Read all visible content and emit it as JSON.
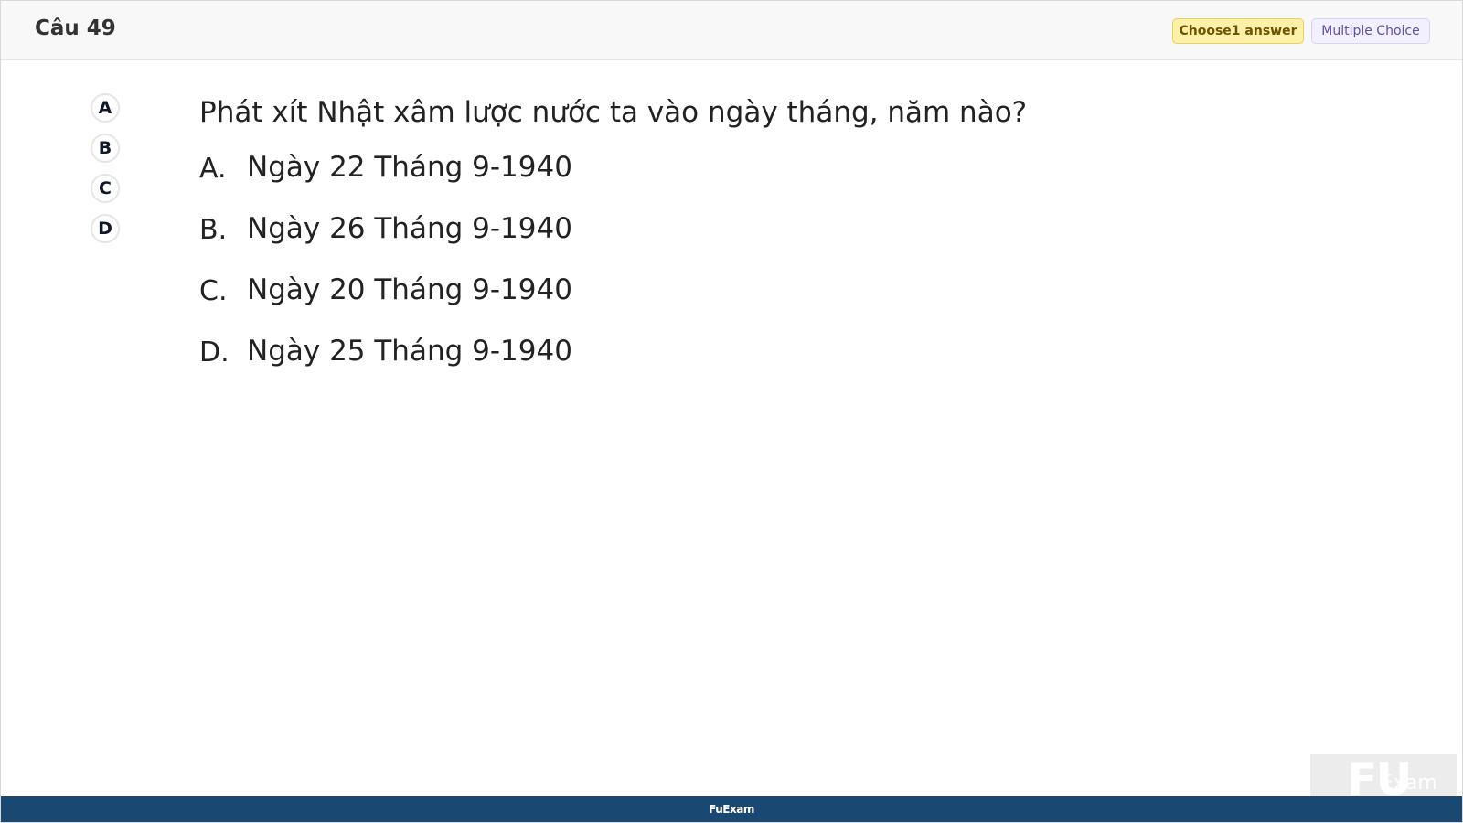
{
  "header": {
    "question_number": "Câu 49",
    "choose_badge": "Choose1 answer",
    "type_badge": "Multiple Choice"
  },
  "navigator": {
    "choices": [
      "A",
      "B",
      "C",
      "D"
    ]
  },
  "question": {
    "text": "Phát xít Nhật xâm lược nước ta vào ngày tháng, năm nào?",
    "answers": [
      {
        "letter": "A.",
        "text": "Ngày 22 Tháng 9-1940"
      },
      {
        "letter": "B.",
        "text": "Ngày 26 Tháng 9-1940"
      },
      {
        "letter": "C.",
        "text": "Ngày 20 Tháng 9-1940"
      },
      {
        "letter": "D.",
        "text": "Ngày 25 Tháng 9-1940"
      }
    ]
  },
  "watermark": {
    "mark": "FU",
    "text": "Exam"
  },
  "footer": {
    "brand": "FuExam"
  },
  "colors": {
    "header_background": "#f8f8f8",
    "choose_badge_background": "#fdf0a8",
    "type_badge_background": "#f2efff",
    "footer_background": "#194972"
  }
}
